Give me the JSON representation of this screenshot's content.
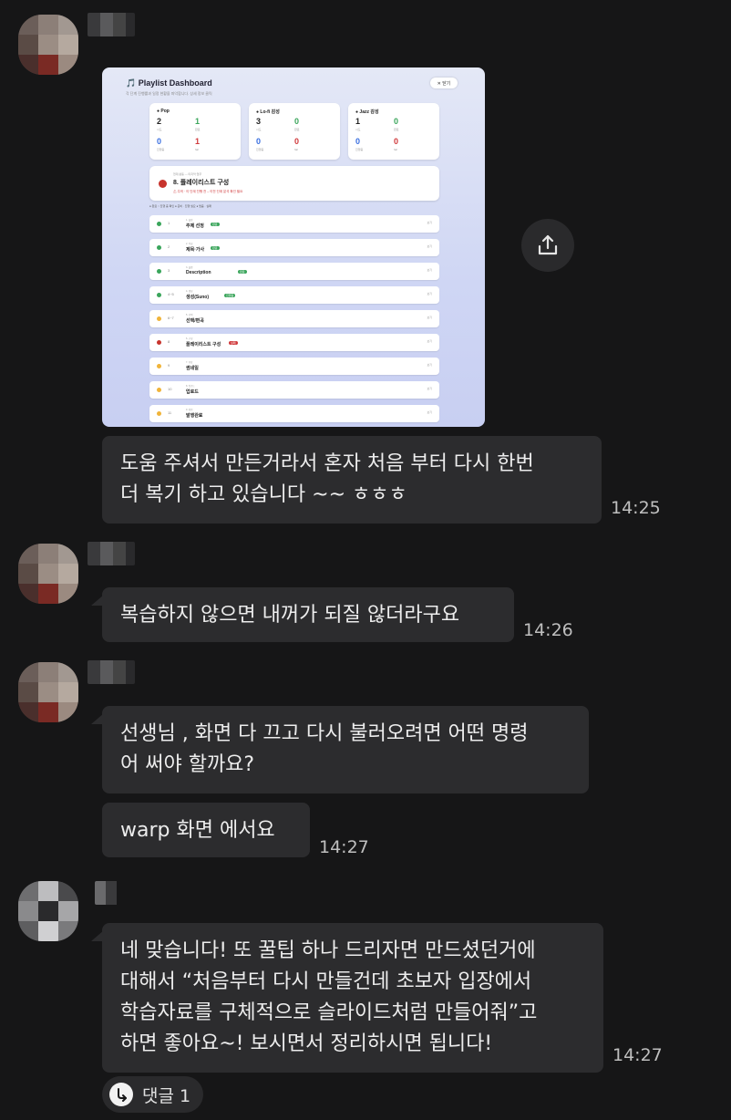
{
  "colors": {
    "background": "#161617",
    "bubble": "#2c2c2e",
    "text": "#ededed",
    "time": "#bfbfbf"
  },
  "messages": [
    {
      "text": "도움 주셔서 만든거라서 혼자 처음 부터 다시 한번\n더 복기 하고 있습니다 ~~ ㅎㅎㅎ",
      "time": "14:25"
    },
    {
      "text": "복습하지 않으면 내꺼가 되질 않더라구요",
      "time": "14:26"
    },
    {
      "text": "선생님 , 화면 다 끄고 다시 불러오려면 어떤 명령\n어 써야 할까요?"
    },
    {
      "text": "warp 화면 에서요",
      "time": "14:27"
    },
    {
      "text": "네 맞습니다! 또 꿀팁 하나 드리자면 만드셨던거에\n대해서 “처음부터 다시 만들건데 초보자 입장에서\n학습자료를 구체적으로 슬라이드처럼 만들어줘”고\n하면 좋아요~! 보시면서 정리하시면 됩니다!",
      "time": "14:27"
    }
  ],
  "reply": {
    "label": "댓글 1",
    "icon": "reply-icon"
  },
  "share": {
    "icon": "share-icon"
  },
  "dashboard": {
    "title": "🎵 Playlist Dashboard",
    "subtitle": "각 단계 진행률과 일정 현황을 파악합니다. 상세 정보 클릭",
    "close": "✕ 닫기",
    "stats": [
      {
        "name": "● Pop",
        "a": "2",
        "b": "1",
        "c": "0",
        "d": "1",
        "la": "시도",
        "lb": "완료",
        "lc": "진행중",
        "ld": "fail"
      },
      {
        "name": "● Lo-fi 감성",
        "a": "3",
        "b": "0",
        "c": "0",
        "d": "0",
        "la": "시도",
        "lb": "완료",
        "lc": "진행중",
        "ld": "fail"
      },
      {
        "name": "● Jazz 감성",
        "a": "1",
        "b": "0",
        "c": "0",
        "d": "0",
        "la": "시도",
        "lb": "완료",
        "lc": "진행중",
        "ld": "fail"
      }
    ],
    "current": {
      "small": "현재 활동 — 마지막 업무",
      "title": "8. 플레이리스트 구성",
      "warn": "⚠ 주의 · 이 단계 진행 전 – 이전 단계 분석 확인 필요"
    },
    "legend": "● 완료 ○ 진행 중 확인  ● 준비 · 진행 필요   ● 멈춤 · 실패",
    "rows": [
      {
        "num": "1",
        "cat": "1. 설정",
        "name": "주제 선정",
        "tag": "완료",
        "tagColor": "#3aa55b",
        "dot": "#3aa55b",
        "act": "보기"
      },
      {
        "num": "2",
        "cat": "2. 작성",
        "name": "제목·가사",
        "tag": "완료",
        "tagColor": "#3aa55b",
        "dot": "#3aa55b",
        "act": "보기"
      },
      {
        "num": "3",
        "cat": "3. 설명",
        "name": "Description",
        "tag": "완료",
        "tagColor": "#3aa55b",
        "dot": "#3aa55b",
        "act": "보기"
      },
      {
        "num": "4~5",
        "cat": "4. 생성",
        "name": "생성(Suno)",
        "tag": "진행중",
        "tagColor": "#3aa55b",
        "dot": "#3aa55b",
        "act": "보기"
      },
      {
        "num": "6~7",
        "cat": "5. 선택",
        "name": "선택/편곡",
        "tag": "",
        "tagColor": "",
        "dot": "#f0b43a",
        "act": "보기"
      },
      {
        "num": "8",
        "cat": "6. 구성",
        "name": "플레이리스트 구성",
        "tag": "실패",
        "tagColor": "#d0393b",
        "dot": "#c8342d",
        "act": "보기"
      },
      {
        "num": "9",
        "cat": "7. 영상",
        "name": "썸네일",
        "tag": "",
        "tagColor": "",
        "dot": "#f0b43a",
        "act": "보기"
      },
      {
        "num": "10",
        "cat": "8. 업로드",
        "name": "업로드",
        "tag": "",
        "tagColor": "",
        "dot": "#f0b43a",
        "act": "보기"
      },
      {
        "num": "11",
        "cat": "9. 확인",
        "name": "발행완료",
        "tag": "",
        "tagColor": "",
        "dot": "#f0b43a",
        "act": "보기"
      }
    ]
  }
}
